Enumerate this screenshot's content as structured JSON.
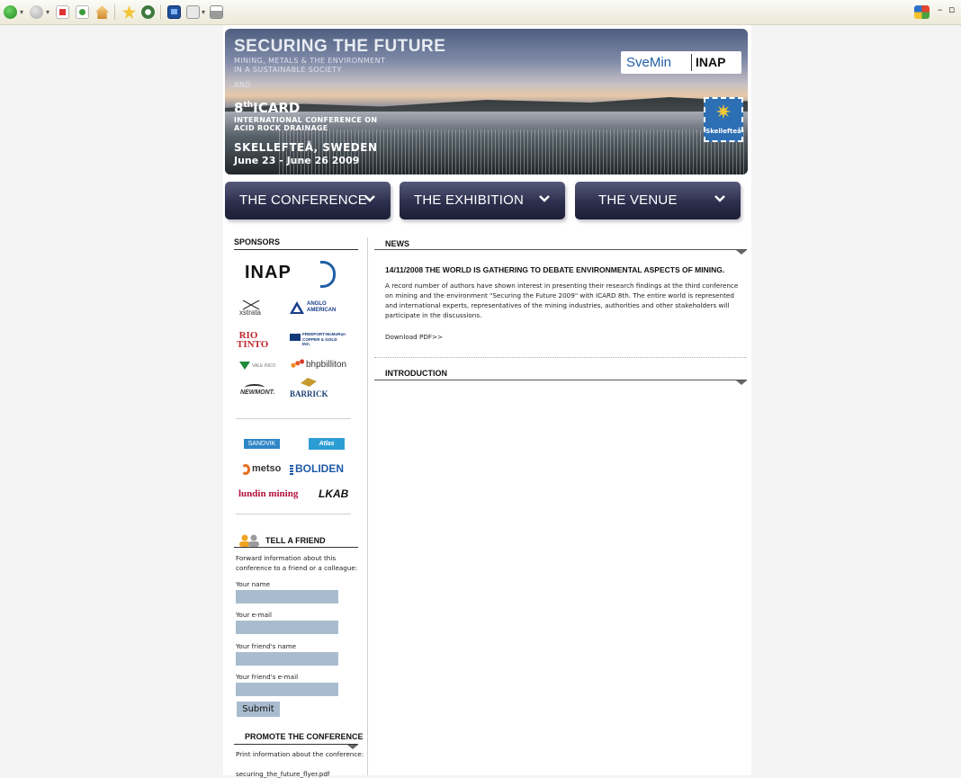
{
  "browser": {
    "icons": [
      "back-icon",
      "forward-icon",
      "stop-icon",
      "refresh-icon",
      "home-icon",
      "favorites-icon",
      "history-icon",
      "rss-icon",
      "mail-icon",
      "print-icon"
    ],
    "window_icons": [
      "windows-flag-icon",
      "minimize-icon",
      "restore-icon"
    ]
  },
  "banner": {
    "title": "SECURING THE FUTURE",
    "subtitle_line1": "MINING, METALS & THE ENVIRONMENT",
    "subtitle_line2": "IN A SUSTAINABLE SOCIETY",
    "and": "AND",
    "icard_num": "8",
    "icard_sup": "th",
    "icard_name": "ICARD",
    "icard_line1": "INTERNATIONAL CONFERENCE ON",
    "icard_line2": "ACID ROCK DRAINAGE",
    "city": "SKELLEFTEÅ, SWEDEN",
    "date": "June 23 - June 26 2009",
    "logo_svemin": "SveMin",
    "logo_inap": "INAP",
    "stamp_label": "Skellefteå"
  },
  "nav": [
    {
      "label": "THE CONFERENCE"
    },
    {
      "label": "THE EXHIBITION"
    },
    {
      "label": "THE VENUE"
    }
  ],
  "sidebar": {
    "sponsors_heading": "SPONSORS",
    "sponsors": [
      "INAP",
      "xstrata",
      "ANGLO AMERICAN",
      "RIO TINTO",
      "FREEPORT-McMoRan COPPER & GOLD INC.",
      "VALE INCO",
      "bhpbilliton",
      "NEWMONT.",
      "BARRICK",
      "SANDVIK",
      "Atlas Copco",
      "metso",
      "BOLIDEN",
      "lundin mining",
      "LKAB"
    ],
    "tell_heading": "TELL A FRIEND",
    "tell_text": "Forward information about this conference to a friend or a colleague:",
    "form": {
      "your_name": "Your name",
      "your_email": "Your e-mail",
      "friend_name": "Your friend's name",
      "friend_email": "Your friend's e-mail",
      "submit": "Submit"
    },
    "promote_heading": "PROMOTE THE CONFERENCE",
    "promote_text": "Print information about the conference:",
    "promote_file": "securing_the_future_flyer.pdf"
  },
  "main": {
    "news_heading": "NEWS",
    "news_title": "14/11/2008 THE WORLD IS GATHERING TO DEBATE ENVIRONMENTAL ASPECTS OF MINING.",
    "news_body": "A record number of authors have shown interest in presenting their research findings at the third conference on mining and the environment \"Securing the Future 2009\" with ICARD 8th. The entire world is represented and international experts, representatives of the mining industries, authorities and other stakeholders will participate in the discussions.",
    "download": "Download PDF>>",
    "intro_heading": "INTRODUCTION"
  },
  "colors": {
    "nav_bg": "#2c2f4c",
    "input_bg": "#a9bccf",
    "page_bg": "#f4f4f4"
  }
}
